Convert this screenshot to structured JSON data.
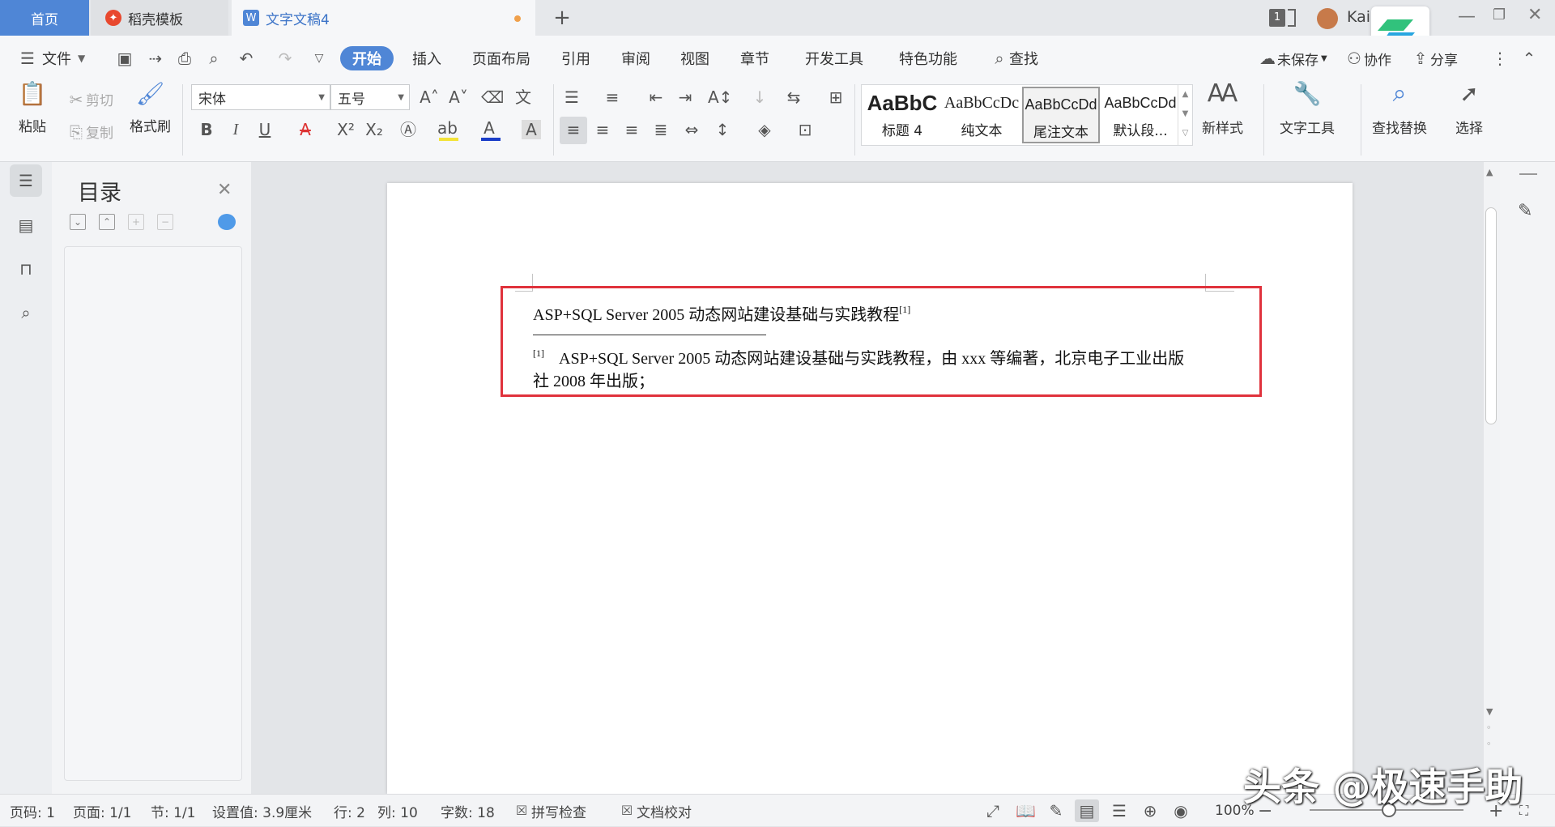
{
  "tabs": {
    "home": "首页",
    "template": "稻壳模板",
    "doc": "文字文稿4",
    "doc_icon": "W"
  },
  "top_right": {
    "count": "1",
    "user": "Kai"
  },
  "menu": {
    "file": "文件",
    "items": [
      "开始",
      "插入",
      "页面布局",
      "引用",
      "审阅",
      "视图",
      "章节",
      "开发工具",
      "特色功能"
    ],
    "search": "查找",
    "unsaved": "未保存",
    "collab": "协作",
    "share": "分享"
  },
  "ribbon": {
    "paste": "粘贴",
    "cut": "剪切",
    "copy": "复制",
    "format_painter": "格式刷",
    "font": "宋体",
    "size": "五号",
    "styles": [
      {
        "preview": "AaBbC",
        "name": "标题 4"
      },
      {
        "preview": "AaBbCcDc",
        "name": "纯文本"
      },
      {
        "preview": "AaBbCcDd",
        "name": "尾注文本"
      },
      {
        "preview": "AaBbCcDd",
        "name": "默认段..."
      }
    ],
    "new_style": "新样式",
    "text_tools": "文字工具",
    "find_replace": "查找替换",
    "select": "选择",
    "font_color": "#1a3ec8",
    "highlight_color": "#f3e33a"
  },
  "toc": {
    "title": "目录"
  },
  "document": {
    "title_line": "ASP+SQL Server 2005 动态网站建设基础与实践教程",
    "title_ref": "[1]",
    "footnote_ref": "[1]",
    "footnote_line1": "ASP+SQL Server 2005 动态网站建设基础与实践教程，由 xxx 等编著，北京电子工业出版",
    "footnote_line2": "社 2008 年出版；"
  },
  "status": {
    "page": "页码: 1",
    "pages": "页面: 1/1",
    "section": "节: 1/1",
    "setting": "设置值: 3.9厘米",
    "row": "行: 2",
    "col": "列: 10",
    "words": "字数: 18",
    "spell": "拼写检查",
    "proof": "文档校对",
    "zoom": "100%"
  },
  "watermark": "头条 @极速手助"
}
